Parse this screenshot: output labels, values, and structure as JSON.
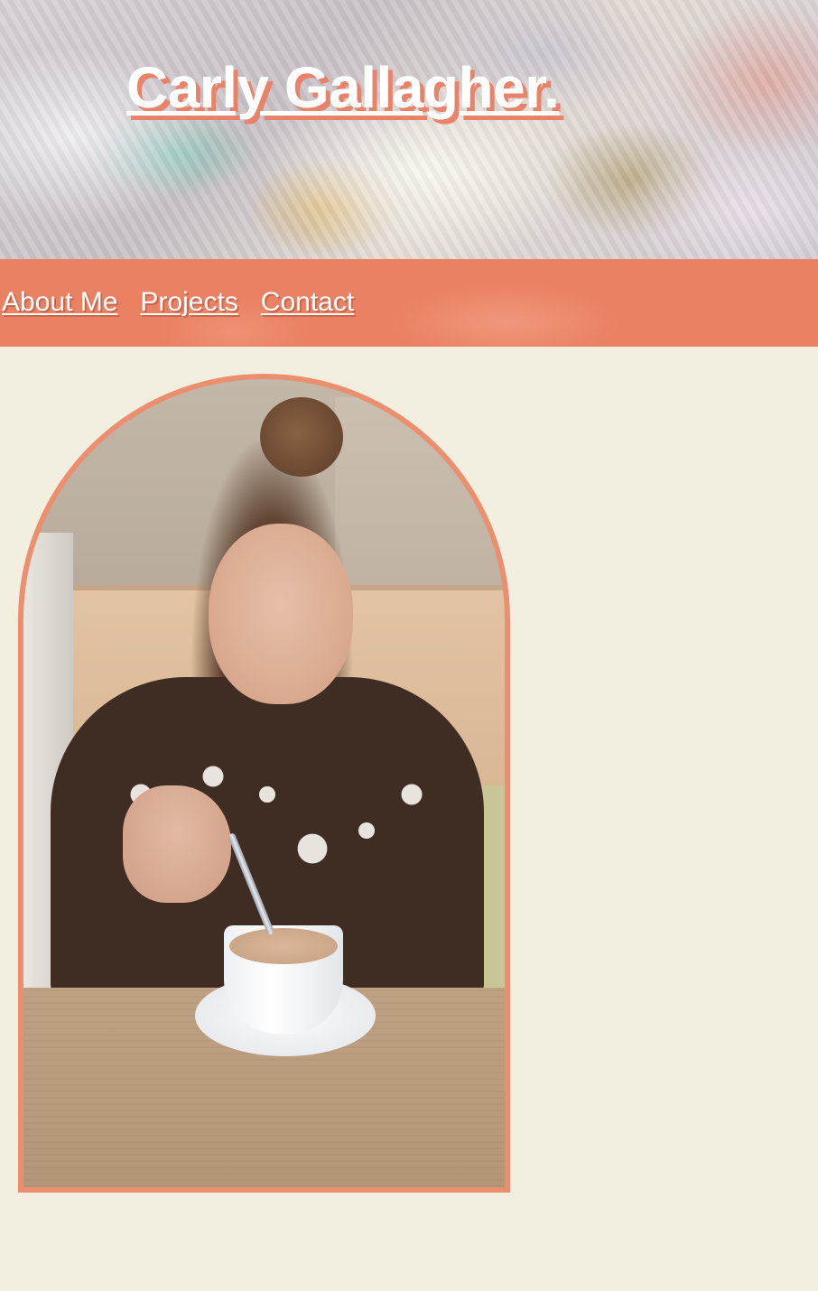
{
  "site": {
    "title": "Carly Gallagher."
  },
  "nav": {
    "items": [
      {
        "label": "About Me"
      },
      {
        "label": "Projects"
      },
      {
        "label": "Contact"
      }
    ]
  },
  "colors": {
    "background": "#f3efe0",
    "accent": "#ea8163",
    "frame": "#ec8f6f",
    "text_light": "#ffffff"
  },
  "icons": {
    "portrait": "portrait-photo"
  }
}
